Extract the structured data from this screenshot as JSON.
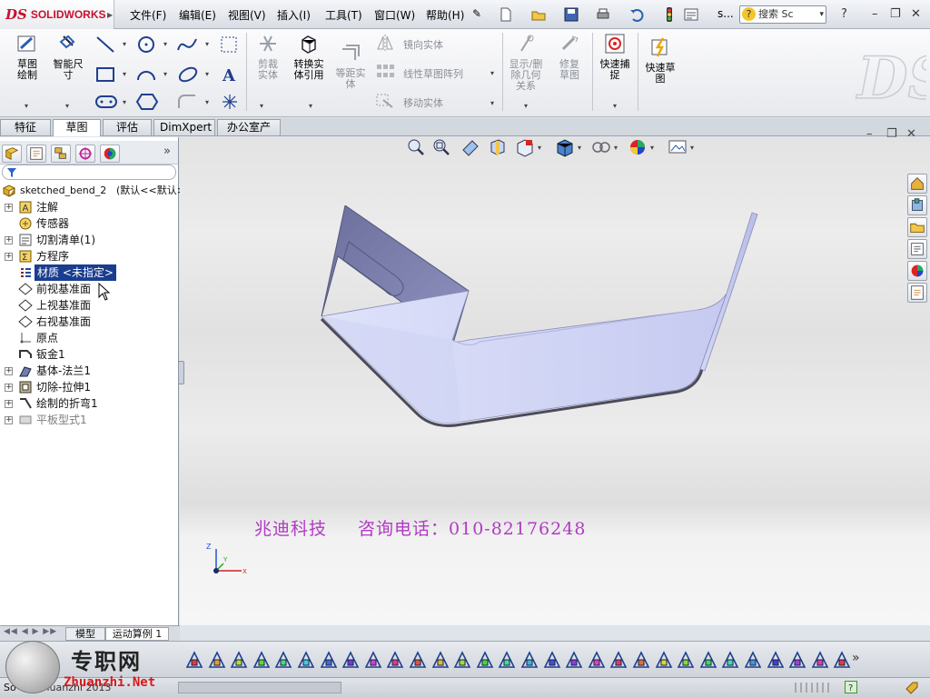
{
  "app": {
    "logo_prefix": "DS",
    "logo_text": "SOLIDWORKS"
  },
  "menu": {
    "items": [
      "文件(F)",
      "编辑(E)",
      "视图(V)",
      "插入(I)",
      "工具(T)",
      "窗口(W)",
      "帮助(H)"
    ]
  },
  "search": {
    "placeholder": "搜索 Sc",
    "help_label": "?"
  },
  "ribbon": {
    "sketch": "草图绘制",
    "smart_dim": "智能尺寸",
    "trim": "剪裁实体",
    "convert": "转换实体引用",
    "offset": "等距实体",
    "mirror": "镜向实体",
    "linear_pattern": "线性草图阵列",
    "move": "移动实体",
    "show_relations": "显示/删除几何关系",
    "repair": "修复草图",
    "quick_snap": "快速捕捉",
    "rapid_sketch": "快速草图"
  },
  "tabs": [
    "特征",
    "草图",
    "评估",
    "DimXpert",
    "办公室产品"
  ],
  "active_tab": "草图",
  "feature_tree": {
    "root": "sketched_bend_2",
    "root_config": "(默认<<默认>",
    "items": [
      {
        "label": "注解",
        "expandable": true,
        "icon": "annotations-icon"
      },
      {
        "label": "传感器",
        "expandable": false,
        "icon": "sensor-icon"
      },
      {
        "label": "切割清单(1)",
        "expandable": true,
        "icon": "cut-list-icon"
      },
      {
        "label": "方程序",
        "expandable": true,
        "icon": "equations-icon"
      },
      {
        "label": "材质 <未指定>",
        "expandable": false,
        "icon": "material-icon",
        "selected": true
      },
      {
        "label": "前视基准面",
        "expandable": false,
        "icon": "plane-icon"
      },
      {
        "label": "上视基准面",
        "expandable": false,
        "icon": "plane-icon"
      },
      {
        "label": "右视基准面",
        "expandable": false,
        "icon": "plane-icon"
      },
      {
        "label": "原点",
        "expandable": false,
        "icon": "origin-icon"
      },
      {
        "label": "钣金1",
        "expandable": false,
        "icon": "sheet-metal-icon"
      },
      {
        "label": "基体-法兰1",
        "expandable": true,
        "icon": "base-flange-icon"
      },
      {
        "label": "切除-拉伸1",
        "expandable": true,
        "icon": "cut-extrude-icon"
      },
      {
        "label": "绘制的折弯1",
        "expandable": true,
        "icon": "sketched-bend-icon"
      },
      {
        "label": "平板型式1",
        "expandable": true,
        "icon": "flat-pattern-icon",
        "suppressed": true
      }
    ]
  },
  "bottom_tabs": [
    "模型",
    "运动算例 1"
  ],
  "watermark": {
    "company": "兆迪科技",
    "contact": "咨询电话：010-82176248"
  },
  "triad": {
    "z": "Z",
    "y": "Y",
    "x": "X"
  },
  "status": {
    "left_text": "So",
    "middle_text": "Zhuanzhi 2013"
  },
  "site_logo": {
    "cn": "专职网",
    "en": "Zhuanzhi.Net"
  },
  "colors": {
    "selection": "#1a3d8f",
    "watermark": "#b13ac4",
    "part_face": "#c9cdf0",
    "part_edge": "#6f6f9a",
    "brand": "#c8102e"
  }
}
